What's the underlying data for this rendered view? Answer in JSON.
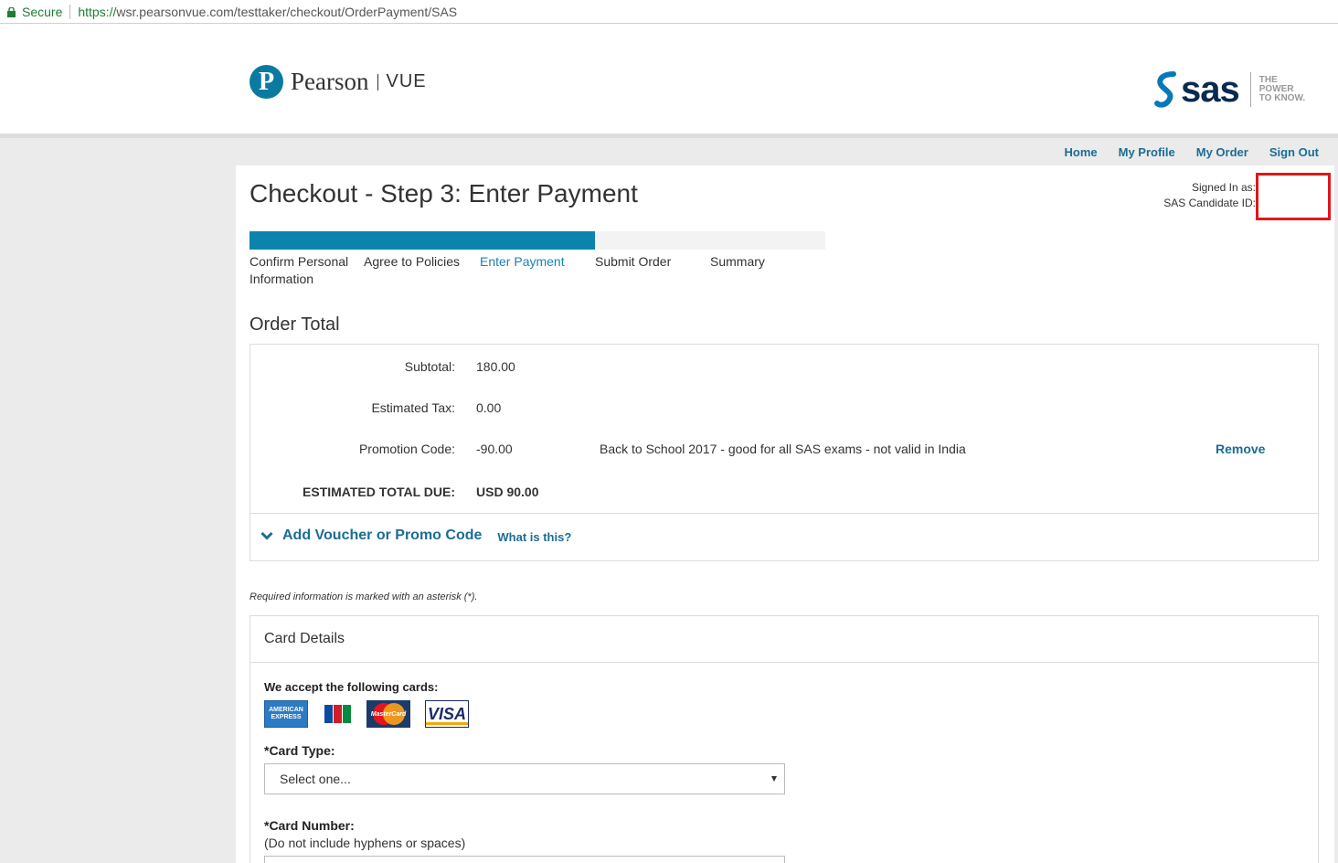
{
  "browser": {
    "secure_label": "Secure",
    "url_scheme": "https://",
    "url_rest": "wsr.pearsonvue.com/testtaker/checkout/OrderPayment/SAS"
  },
  "header": {
    "pearson_word": "Pearson",
    "pearson_product": "VUE",
    "sas_text": "sas",
    "sas_tagline": [
      "THE",
      "POWER",
      "TO KNOW."
    ]
  },
  "nav": {
    "home": "Home",
    "profile": "My Profile",
    "order": "My Order",
    "signout": "Sign Out"
  },
  "page": {
    "title": "Checkout - Step 3: Enter Payment",
    "signed_in_label": "Signed In as:",
    "candidate_id_label": "SAS Candidate ID:"
  },
  "progress": {
    "percent": 60,
    "steps": [
      {
        "line1": "Confirm Personal",
        "line2": "Information"
      },
      {
        "line1": "Agree to Policies",
        "line2": ""
      },
      {
        "line1": "Enter Payment",
        "line2": ""
      },
      {
        "line1": "Submit Order",
        "line2": ""
      },
      {
        "line1": "Summary",
        "line2": ""
      }
    ],
    "active_index": 2
  },
  "order": {
    "heading": "Order Total",
    "subtotal_label": "Subtotal:",
    "subtotal": "180.00",
    "tax_label": "Estimated Tax:",
    "tax": "0.00",
    "promo_label": "Promotion Code:",
    "promo": "-90.00",
    "promo_desc": "Back to School 2017 - good for all SAS exams - not valid in India",
    "remove": "Remove",
    "total_label": "ESTIMATED TOTAL DUE:",
    "total": "USD 90.00",
    "voucher_label": "Add Voucher or Promo Code",
    "what_is_this": "What is this?"
  },
  "form": {
    "required_note": "Required information is marked with an asterisk (*).",
    "card_details_title": "Card Details",
    "accept_label": "We accept the following cards:",
    "card_logos": {
      "amex_line1": "AMERICAN",
      "amex_line2": "EXPRESS",
      "jcb": "JCB",
      "mastercard": "MasterCard",
      "visa": "VISA"
    },
    "card_type_label": "*Card Type:",
    "card_type_value": "Select one...",
    "card_number_label": "*Card Number:",
    "card_number_hint": "(Do not include hyphens or spaces)"
  }
}
